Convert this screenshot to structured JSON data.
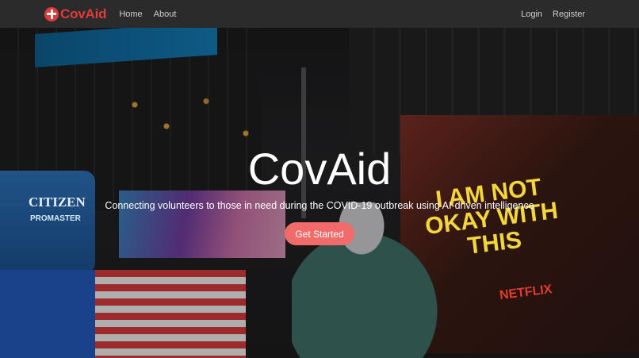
{
  "navbar": {
    "brand": "CovAid",
    "links": [
      {
        "label": "Home"
      },
      {
        "label": "About"
      }
    ],
    "right_links": [
      {
        "label": "Login"
      },
      {
        "label": "Register"
      }
    ]
  },
  "hero": {
    "title": "CovAid",
    "subtitle": "Connecting volunteers to those in need during the COVID-19 outbreak using AI-driven intelligence",
    "cta_label": "Get Started"
  },
  "background": {
    "billboard_citizen": "CITIZEN",
    "billboard_promaster": "PROMASTER",
    "billboard_main": "I AM NOT OKAY WITH THIS",
    "billboard_netflix": "NETFLIX"
  },
  "colors": {
    "brand": "#e03a3a",
    "navbar_bg": "#2b2b2b",
    "cta_bg": "#f26b6b"
  },
  "icons": {
    "brand_icon": "red-cross-icon"
  }
}
